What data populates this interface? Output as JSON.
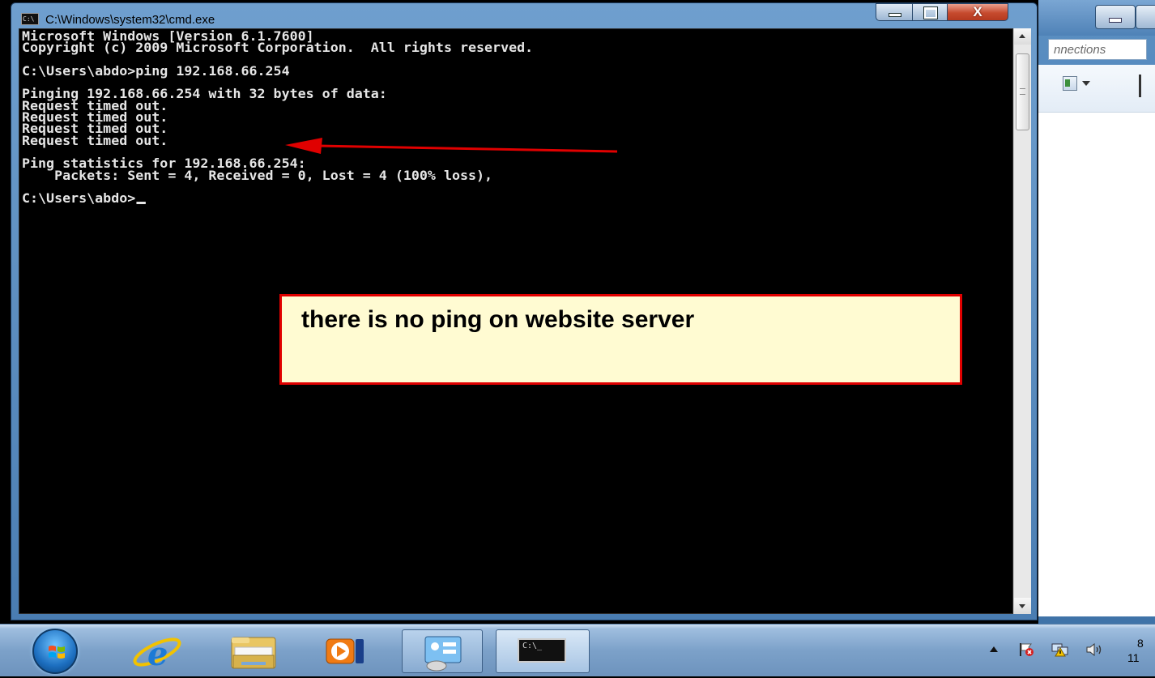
{
  "background_window": {
    "address_text": "nnections"
  },
  "cmd_window": {
    "title": "C:\\Windows\\system32\\cmd.exe",
    "icon_text": "C:\\",
    "close_symbol": "X",
    "console_lines": [
      "Microsoft Windows [Version 6.1.7600]",
      "Copyright (c) 2009 Microsoft Corporation.  All rights reserved.",
      "",
      "C:\\Users\\abdo>ping 192.168.66.254",
      "",
      "Pinging 192.168.66.254 with 32 bytes of data:",
      "Request timed out.",
      "Request timed out.",
      "Request timed out.",
      "Request timed out.",
      "",
      "Ping statistics for 192.168.66.254:",
      "    Packets: Sent = 4, Received = 0, Lost = 4 (100% loss),",
      ""
    ],
    "prompt": "C:\\Users\\abdo>"
  },
  "annotation": {
    "callout_text": "there is no ping on website server",
    "arrow_color": "#e00000",
    "border_color": "#e00000",
    "fill_color": "#fffbd2"
  },
  "taskbar": {
    "cmd_icon_text": "C:\\_",
    "clock_line1": "8",
    "clock_line2": "11"
  },
  "icons": {
    "start": "windows-orb-icon",
    "ie": "internet-explorer-icon",
    "explorer": "folder-icon",
    "media": "media-player-icon",
    "panel": "control-panel-icon",
    "cmd": "command-prompt-icon",
    "tray": [
      "chevron-up-icon",
      "action-center-flag-icon",
      "network-icon",
      "volume-icon"
    ]
  }
}
